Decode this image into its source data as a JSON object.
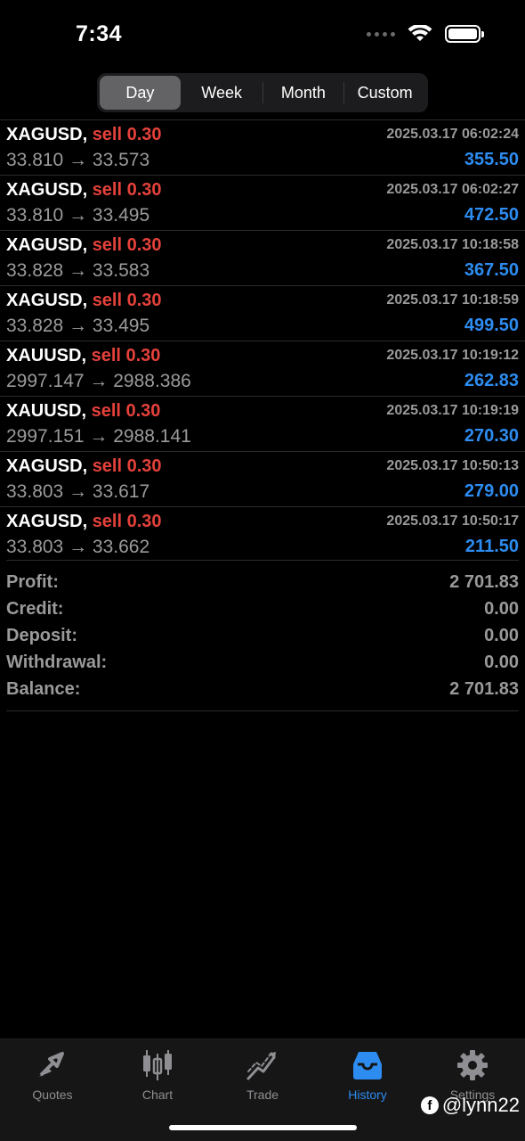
{
  "status_bar": {
    "time": "7:34"
  },
  "segments": [
    {
      "label": "Day",
      "active": true
    },
    {
      "label": "Week",
      "active": false
    },
    {
      "label": "Month",
      "active": false
    },
    {
      "label": "Custom",
      "active": false
    }
  ],
  "trades": [
    {
      "symbol": "XAGUSD,",
      "side": "sell 0.30",
      "time": "2025.03.17 06:02:24",
      "prices": "33.810 → 33.573",
      "profit": "355.50"
    },
    {
      "symbol": "XAGUSD,",
      "side": "sell 0.30",
      "time": "2025.03.17 06:02:27",
      "prices": "33.810 → 33.495",
      "profit": "472.50"
    },
    {
      "symbol": "XAGUSD,",
      "side": "sell 0.30",
      "time": "2025.03.17 10:18:58",
      "prices": "33.828 → 33.583",
      "profit": "367.50"
    },
    {
      "symbol": "XAGUSD,",
      "side": "sell 0.30",
      "time": "2025.03.17 10:18:59",
      "prices": "33.828 → 33.495",
      "profit": "499.50"
    },
    {
      "symbol": "XAUUSD,",
      "side": "sell 0.30",
      "time": "2025.03.17 10:19:12",
      "prices": "2997.147 → 2988.386",
      "profit": "262.83"
    },
    {
      "symbol": "XAUUSD,",
      "side": "sell 0.30",
      "time": "2025.03.17 10:19:19",
      "prices": "2997.151 → 2988.141",
      "profit": "270.30"
    },
    {
      "symbol": "XAGUSD,",
      "side": "sell 0.30",
      "time": "2025.03.17 10:50:13",
      "prices": "33.803 → 33.617",
      "profit": "279.00"
    },
    {
      "symbol": "XAGUSD,",
      "side": "sell 0.30",
      "time": "2025.03.17 10:50:17",
      "prices": "33.803 → 33.662",
      "profit": "211.50"
    }
  ],
  "summary": {
    "profit_label": "Profit:",
    "profit_value": "2 701.83",
    "credit_label": "Credit:",
    "credit_value": "0.00",
    "deposit_label": "Deposit:",
    "deposit_value": "0.00",
    "withdrawal_label": "Withdrawal:",
    "withdrawal_value": "0.00",
    "balance_label": "Balance:",
    "balance_value": "2 701.83"
  },
  "tabs": [
    {
      "label": "Quotes",
      "icon": "quotes-icon"
    },
    {
      "label": "Chart",
      "icon": "chart-icon"
    },
    {
      "label": "Trade",
      "icon": "trade-icon"
    },
    {
      "label": "History",
      "icon": "history-icon",
      "active": true
    },
    {
      "label": "Settings",
      "icon": "settings-icon"
    }
  ],
  "watermark": "@lynn22",
  "colors": {
    "sell": "#e5413b",
    "profit": "#2d8cf0",
    "active_tab": "#2d8cf0",
    "muted": "#9a9a9a"
  }
}
